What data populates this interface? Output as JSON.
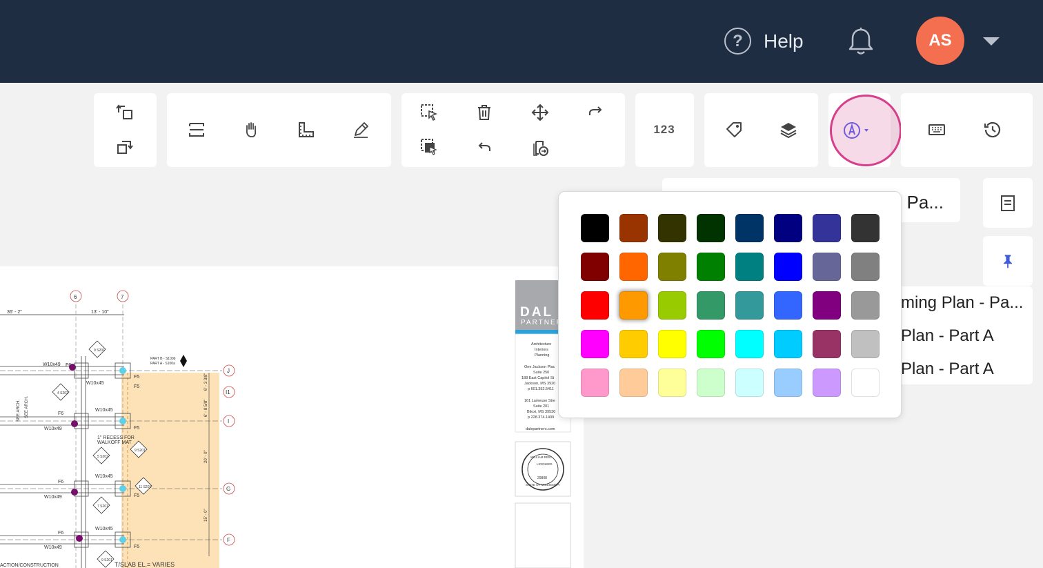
{
  "header": {
    "help_icon_glyph": "?",
    "help_label": "Help",
    "avatar_initials": "AS"
  },
  "toolbar": {
    "count_label": "123"
  },
  "right_panel": {
    "doc_tab_label": "Pa...",
    "sheets": [
      "ming Plan - Pa...",
      "Plan - Part A",
      "Plan - Part A"
    ]
  },
  "color_picker": {
    "selected_index": 17,
    "colors": [
      "#000000",
      "#993300",
      "#333300",
      "#003300",
      "#003366",
      "#000080",
      "#333399",
      "#333333",
      "#800000",
      "#ff6600",
      "#808000",
      "#008000",
      "#008080",
      "#0000ff",
      "#666699",
      "#808080",
      "#ff0000",
      "#ff9900",
      "#99cc00",
      "#339966",
      "#33999a",
      "#3366ff",
      "#800080",
      "#999999",
      "#ff00ff",
      "#ffcc00",
      "#ffff00",
      "#00ff00",
      "#00ffff",
      "#00ccff",
      "#993366",
      "#c0c0c0",
      "#ff99cc",
      "#ffcc99",
      "#ffff99",
      "#ccffcc",
      "#ccffff",
      "#99ccff",
      "#cc99ff",
      "#ffffff"
    ]
  },
  "drawing": {
    "grid_col_labels": [
      "6",
      "7"
    ],
    "grid_row_labels": [
      "J",
      "I1",
      "I",
      "G",
      "F"
    ],
    "dims": [
      "36' - 2\"",
      "13' - 10\""
    ],
    "beam_labels": [
      "W10x49",
      "W10x45",
      "W10x45",
      "W10x49",
      "W10x45",
      "W10x49",
      "W10x45",
      "W10x49"
    ],
    "footing_labels": [
      "F6",
      "F5",
      "F6",
      "F5",
      "F6",
      "F5",
      "F6",
      "F5",
      "F5"
    ],
    "part_b_note": "PART B - S100b",
    "part_a_note": "PART A - S100a",
    "recess_note_1": "1\" RECESS FOR",
    "recess_note_2": "WALKOFF MAT",
    "slab_note": "T/SLAB EL.= VARIES",
    "bottom_note": "ACTION/CONSTRUCTION",
    "see_arch_1": "SEE ARCH.",
    "see_arch_2": "SEE ARCH.",
    "vert_dims": [
      "6' - 3 3/8\"",
      "6' - 8 5/8\"",
      "20' - 0\"",
      "15' - 0\""
    ],
    "section_tags": [
      "9 S201",
      "4 S202",
      "5 S202",
      "9 S201",
      "11 S201",
      "7 S201",
      "9 S201"
    ],
    "title_block": {
      "firm_name": "DAL",
      "firm_sub": "PARTNER",
      "services": [
        "Architecture",
        "Interiors",
        "Planning"
      ],
      "address_1": [
        "One Jackson Plac",
        "Suite 250",
        "188 East Capitol St",
        "Jackson, MS 3920",
        "p 601.352.5411"
      ],
      "address_2": [
        "161 Lameuse Stre",
        "Suite 201",
        "Biloxi, MS 39530",
        "p 228.374.1409"
      ],
      "website": "dalepartners.com",
      "seal_text": [
        "WILLIAM REID",
        "LICENSED",
        "29808",
        "STATE OF MISSISSIPPI"
      ]
    }
  }
}
